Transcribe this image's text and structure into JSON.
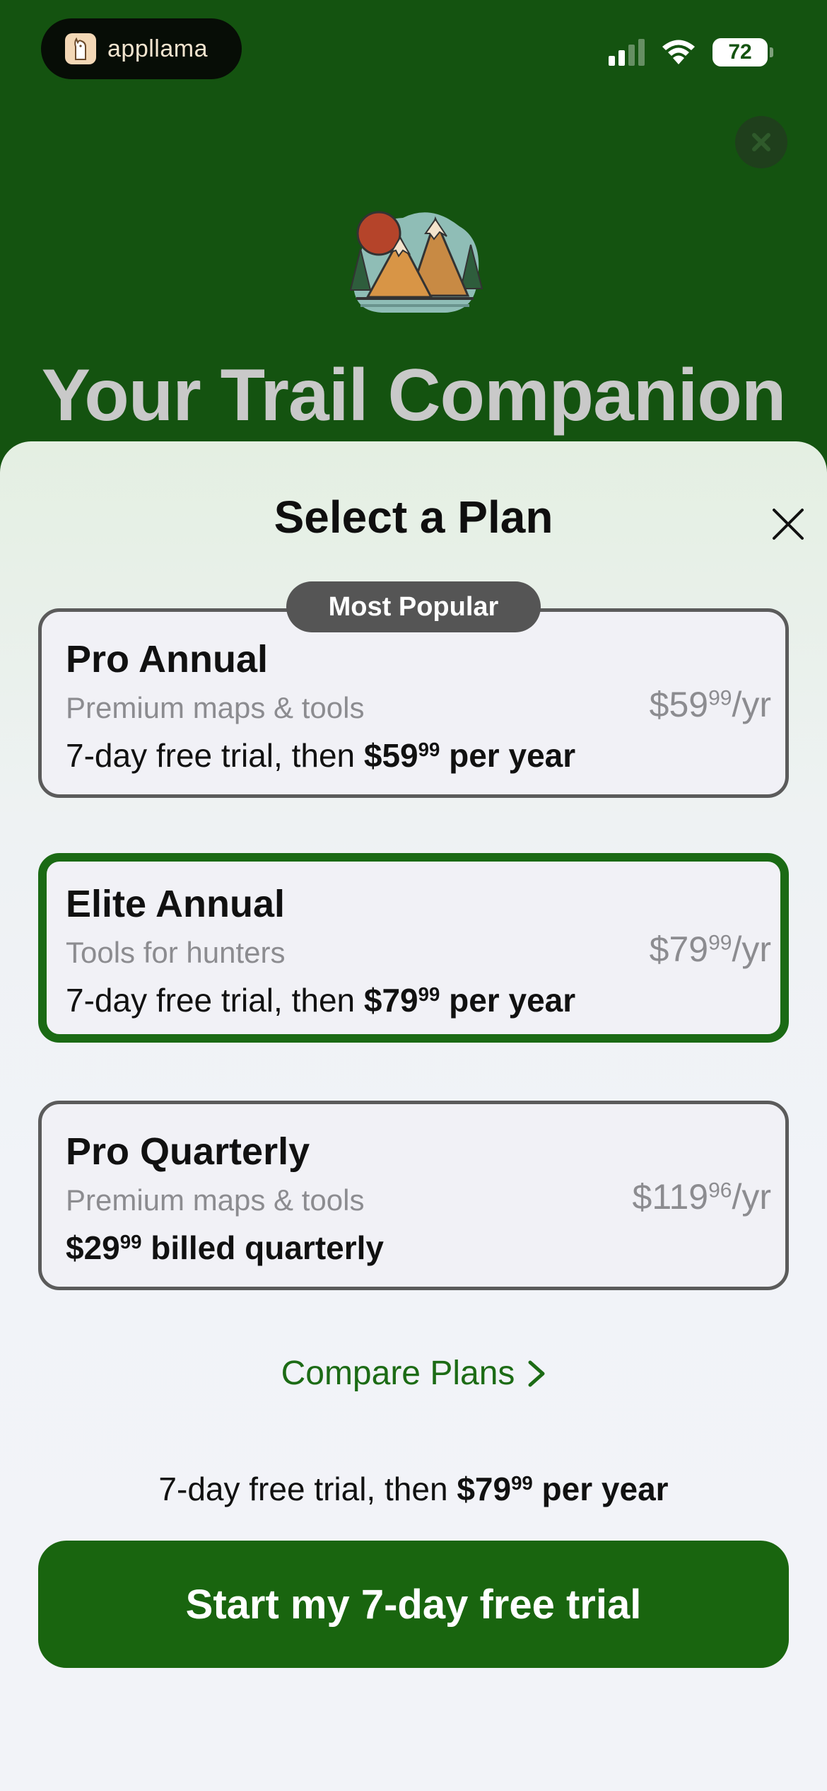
{
  "status_bar": {
    "app_pill_label": "appllama",
    "battery_level": "72",
    "signal_bars_active": 2,
    "signal_bars_total": 4
  },
  "hero": {
    "title": "Your Trail Companion",
    "illustration_icon": "mountain-sun-icon"
  },
  "sheet": {
    "title": "Select a Plan",
    "plans": [
      {
        "name": "Pro Annual",
        "subtitle": "Premium maps & tools",
        "price_main": "$59",
        "price_cents": "99",
        "price_suffix": "/yr",
        "detail_prefix": "7-day free trial, then ",
        "detail_amount": "$59",
        "detail_cents": "99",
        "detail_suffix": " per year",
        "badge": "Most Popular",
        "selected": false
      },
      {
        "name": "Elite Annual",
        "subtitle": "Tools for hunters",
        "price_main": "$79",
        "price_cents": "99",
        "price_suffix": "/yr",
        "detail_prefix": "7-day free trial, then ",
        "detail_amount": "$79",
        "detail_cents": "99",
        "detail_suffix": " per year",
        "selected": true
      },
      {
        "name": "Pro Quarterly",
        "subtitle": "Premium maps & tools",
        "price_main": "$119",
        "price_cents": "96",
        "price_suffix": "/yr",
        "detail_amount": "$29",
        "detail_cents": "99",
        "detail_suffix": " billed quarterly",
        "selected": false
      }
    ],
    "compare_label": "Compare Plans",
    "trial_summary_prefix": "7-day free trial, then ",
    "trial_summary_amount": "$79",
    "trial_summary_cents": "99",
    "trial_summary_suffix": " per year",
    "cta_label": "Start my 7-day free trial"
  },
  "colors": {
    "brand_green": "#19650f",
    "hero_background": "#145310",
    "selected_border": "#1a6a14"
  }
}
